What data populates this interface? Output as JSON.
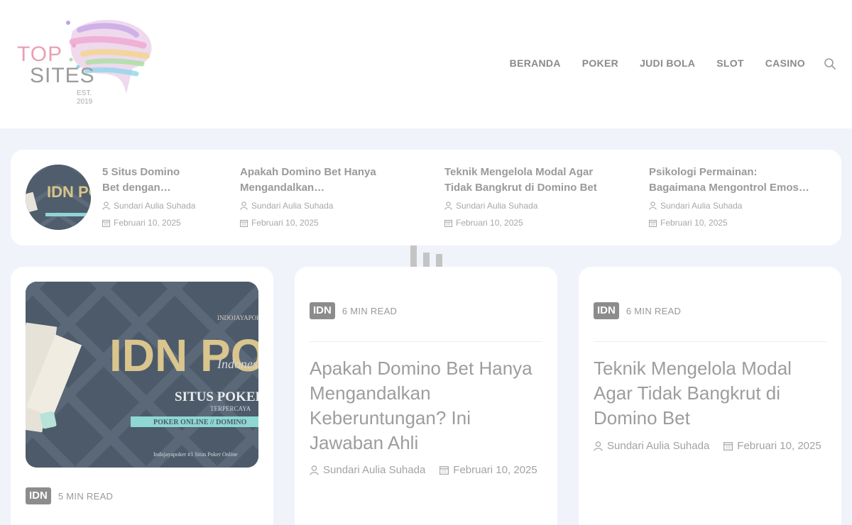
{
  "header": {
    "logo": {
      "line1": "TOP",
      "line2": "SITES",
      "est": "EST.",
      "year": "2019"
    },
    "nav": [
      "BERANDA",
      "POKER",
      "JUDI BOLA",
      "SLOT",
      "CASINO"
    ]
  },
  "strip": {
    "items": [
      {
        "title_line1": "5 Situs Domino",
        "title_line2": "Bet dengan…",
        "author": "Sundari Aulia Suhada",
        "date": "Februari 10, 2025"
      },
      {
        "title_line1": "Apakah Domino Bet Hanya",
        "title_line2": "Mengandalkan…",
        "author": "Sundari Aulia Suhada",
        "date": "Februari 10, 2025"
      },
      {
        "title_line1": "Teknik Mengelola Modal Agar",
        "title_line2": "Tidak Bangkrut di Domino Bet",
        "author": "Sundari Aulia Suhada",
        "date": "Februari 10, 2025"
      },
      {
        "title_line1": "Psikologi Permainan:",
        "title_line2": "Bagaimana Mengontrol Emos…",
        "author": "Sundari Aulia Suhada",
        "date": "Februari 10, 2025"
      }
    ]
  },
  "thumb_text": {
    "idn": "IDN POKER",
    "brand": "INDOJAYAPOKER",
    "sub": "Indonesia",
    "situs": "SITUS POKER",
    "terpercaya": "TERPERCAYA",
    "ribbon": "POKER ONLINE // DOMINO",
    "footer": "Indojayapoker #1 Situs Poker Online"
  },
  "cards": [
    {
      "badge": "IDN",
      "read": "5 MIN READ"
    },
    {
      "badge": "IDN",
      "read": "6 MIN READ",
      "title": "Apakah Domino Bet Hanya Mengandalkan Keberuntungan? Ini Jawaban Ahli",
      "author": "Sundari Aulia Suhada",
      "date": "Februari 10, 2025"
    },
    {
      "badge": "IDN",
      "read": "6 MIN READ",
      "title": "Teknik Mengelola Modal Agar Tidak Bangkrut di Domino Bet",
      "author": "Sundari Aulia Suhada",
      "date": "Februari 10, 2025"
    }
  ],
  "colors": {
    "page_bg": "#f0f3fa",
    "card_bg": "#ffffff",
    "badge_bg": "#8c8c8c",
    "text_muted": "#9d9d9d",
    "logo_pink": "#e9a0b4"
  },
  "icons": {
    "search": "search-icon",
    "author": "user-icon",
    "date": "calendar-icon"
  }
}
